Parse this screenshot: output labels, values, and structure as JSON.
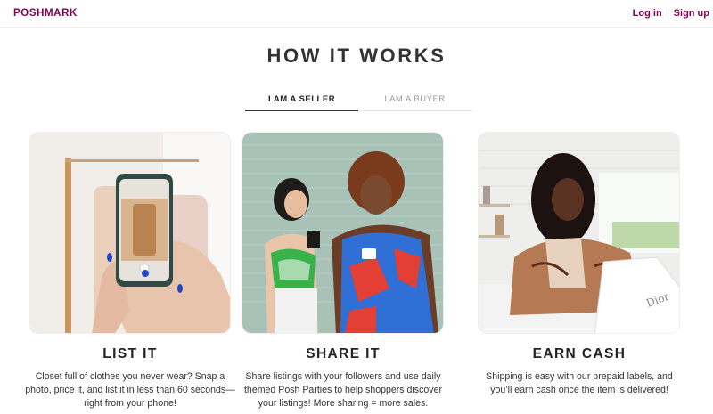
{
  "header": {
    "logo": "POSHMARK",
    "login_label": "Log in",
    "signup_label": "Sign up",
    "accent_color": "#7f0353"
  },
  "page": {
    "title": "HOW IT WORKS"
  },
  "tabs": [
    {
      "label": "I AM A SELLER",
      "active": true
    },
    {
      "label": "I AM A BUYER",
      "active": false
    }
  ],
  "steps": [
    {
      "title": "LIST IT",
      "description": "Closet full of clothes you never wear? Snap a photo, price it, and list it in less than 60 seconds—right from your phone!",
      "image": "photo of a hand holding a phone, photographing clothes on a rack"
    },
    {
      "title": "SHARE IT",
      "description": "Share listings with your followers and use daily themed Posh Parties to help shoppers discover your listings! More sharing = more sales.",
      "image": "photo of two women looking at a phone in front of a brick wall"
    },
    {
      "title": "EARN CASH",
      "description": "Shipping is easy with our prepaid labels, and you’ll earn cash once the item is delivered!",
      "image": "photo of a woman packing a white shopping bag in a kitchen"
    }
  ]
}
